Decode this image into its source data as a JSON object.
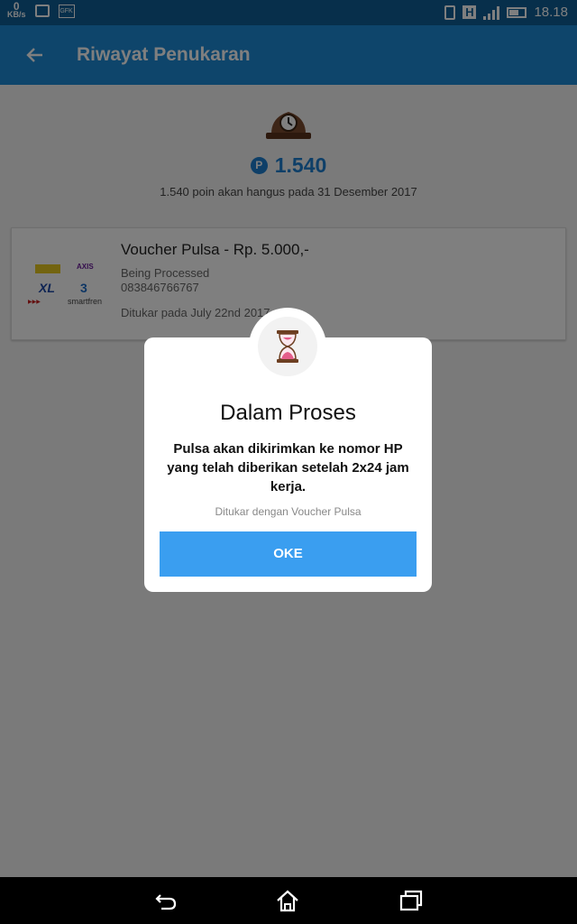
{
  "status_bar": {
    "speed_value": "0",
    "speed_unit": "KB/s",
    "icon_label": "GFK",
    "network_type": "H",
    "time": "18.18",
    "icons": [
      "speed-indicator",
      "image-icon",
      "gfk-icon",
      "vibrate-icon",
      "network-h-icon",
      "signal-icon",
      "battery-icon"
    ]
  },
  "app_bar": {
    "title": "Riwayat Penukaran",
    "back_icon": "arrow-left-icon"
  },
  "points": {
    "icon": "clock-icon",
    "currency_symbol": "P",
    "value": "1.540",
    "expiry_text": "1.540 poin akan hangus pada 31 Desember 2017"
  },
  "history": [
    {
      "title": "Voucher Pulsa - Rp. 5.000,-",
      "status": "Being Processed",
      "phone": "083846766767",
      "date": "Ditukar pada July 22nd 2017, 6:1",
      "logo_texts": [
        "AXIS",
        "XL",
        "3",
        "smartfren"
      ]
    }
  ],
  "dialog": {
    "icon": "hourglass-icon",
    "title": "Dalam Proses",
    "message": "Pulsa akan dikirimkan ke nomor HP yang telah diberikan setelah 2x24 jam kerja.",
    "subtitle": "Ditukar dengan Voucher Pulsa",
    "button_label": "OKE"
  },
  "nav_bar": {
    "icons": [
      "back-icon",
      "home-icon",
      "recent-apps-icon"
    ]
  },
  "colors": {
    "status_bar": "#0f5f97",
    "app_bar": "#1c8ad6",
    "points_accent": "#1c7fd0",
    "button": "#3a9ef0"
  }
}
